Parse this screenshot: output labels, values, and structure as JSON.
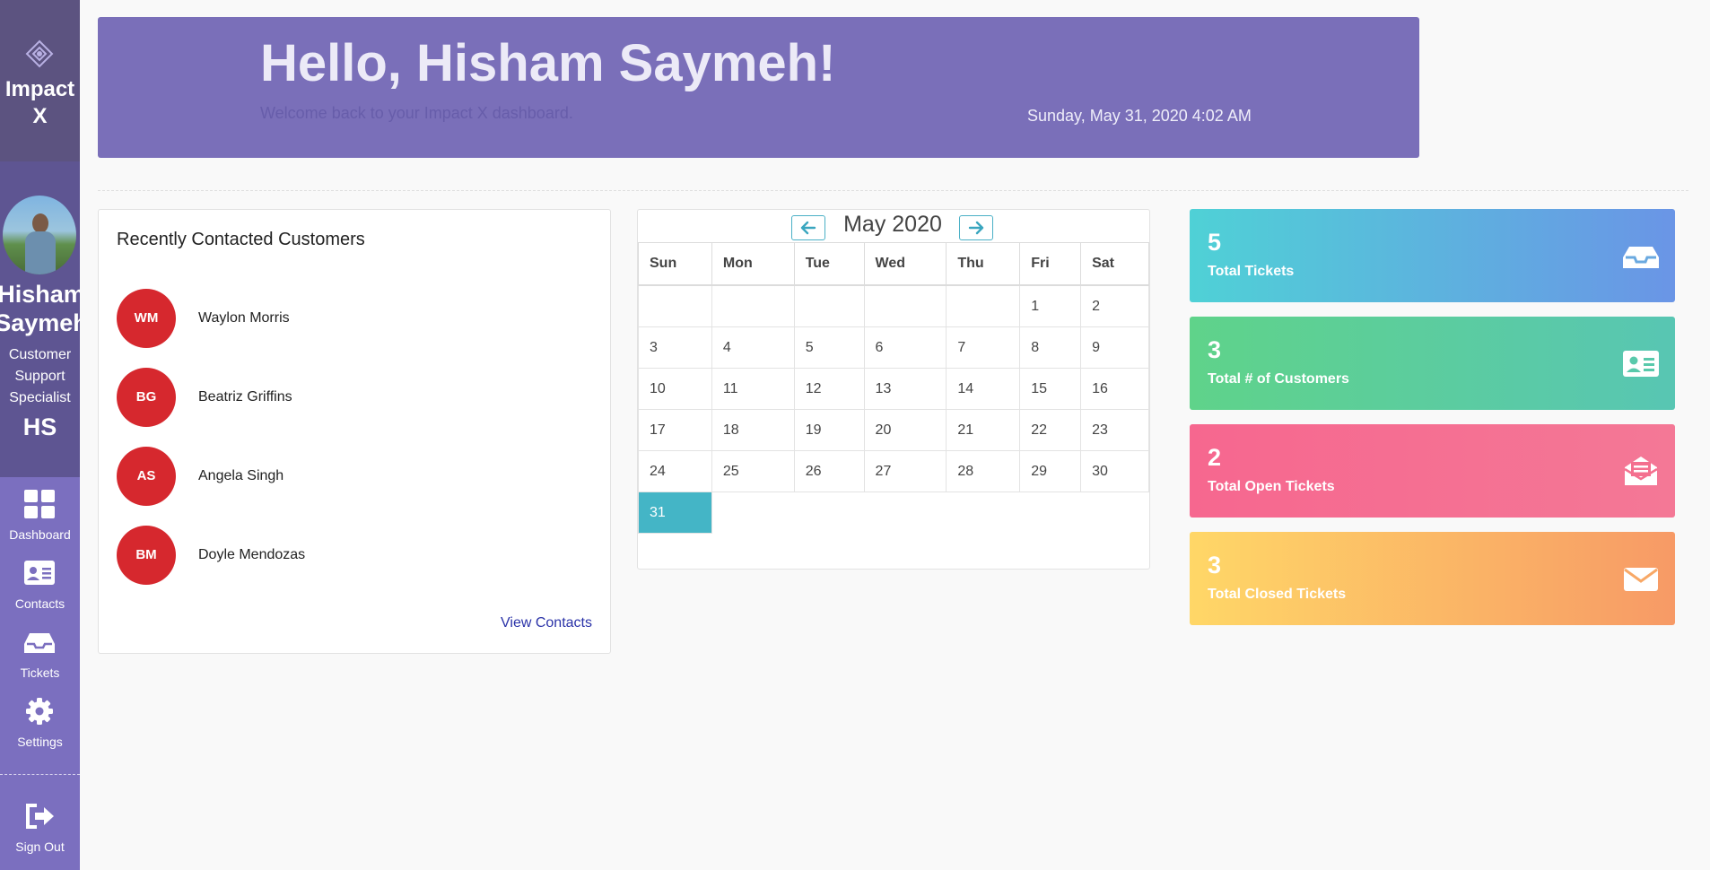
{
  "sidebar": {
    "brand": "Impact\nX",
    "user": {
      "first_name": "Hisham",
      "last_name": "Saymeh",
      "role": "Customer Support Specialist",
      "initials": "HS"
    },
    "nav": [
      {
        "label": "Dashboard",
        "icon": "dashboard-icon"
      },
      {
        "label": "Contacts",
        "icon": "contact-card-icon"
      },
      {
        "label": "Tickets",
        "icon": "inbox-tray-icon"
      },
      {
        "label": "Settings",
        "icon": "gear-icon"
      }
    ],
    "sign_out": {
      "label": "Sign Out",
      "icon": "sign-out-icon"
    }
  },
  "header": {
    "greeting": "Hello, Hisham Saymeh!",
    "subtitle": "Welcome back to your Impact X dashboard.",
    "datetime": "Sunday, May 31, 2020 4:02 AM"
  },
  "recent_customers": {
    "title": "Recently Contacted Customers",
    "customers": [
      {
        "initials": "WM",
        "name": "Waylon Morris"
      },
      {
        "initials": "BG",
        "name": "Beatriz Griffins"
      },
      {
        "initials": "AS",
        "name": "Angela Singh"
      },
      {
        "initials": "BM",
        "name": "Doyle Mendozas"
      }
    ],
    "link_label": "View Contacts",
    "avatar_color": "#d6282e"
  },
  "calendar": {
    "month_label": "May 2020",
    "weekdays": [
      "Sun",
      "Mon",
      "Tue",
      "Wed",
      "Thu",
      "Fri",
      "Sat"
    ],
    "weeks": [
      [
        "",
        "",
        "",
        "",
        "",
        "1",
        "2"
      ],
      [
        "3",
        "4",
        "5",
        "6",
        "7",
        "8",
        "9"
      ],
      [
        "10",
        "11",
        "12",
        "13",
        "14",
        "15",
        "16"
      ],
      [
        "17",
        "18",
        "19",
        "20",
        "21",
        "22",
        "23"
      ],
      [
        "24",
        "25",
        "26",
        "27",
        "28",
        "29",
        "30"
      ],
      [
        "31"
      ]
    ],
    "today": "31",
    "highlight_color": "#44b5c6"
  },
  "stats": [
    {
      "value": "5",
      "label": "Total Tickets",
      "icon": "inbox-tray-icon"
    },
    {
      "value": "3",
      "label": "Total # of Customers",
      "icon": "contact-card-icon"
    },
    {
      "value": "2",
      "label": "Total Open Tickets",
      "icon": "open-envelope-icon"
    },
    {
      "value": "3",
      "label": "Total Closed Tickets",
      "icon": "closed-envelope-icon"
    }
  ],
  "colors": {
    "sidebar": "#7b6fbf",
    "hero": "#7a6fb9",
    "accent_link": "#2b33a8"
  }
}
